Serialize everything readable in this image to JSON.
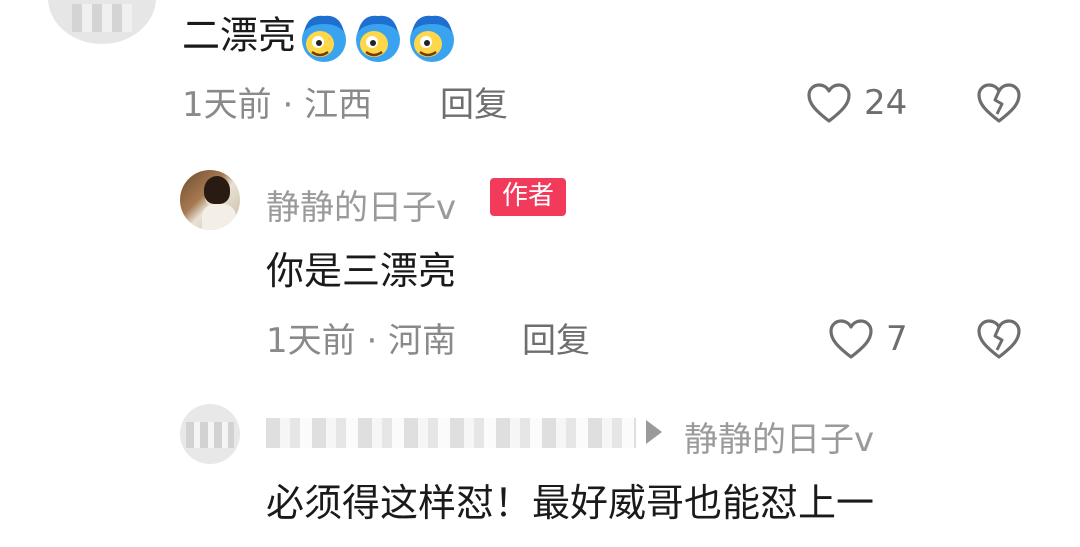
{
  "comments": [
    {
      "text": "二漂亮",
      "emoji": "laughing-face-emoji",
      "time": "1天前",
      "separator": "·",
      "location": "江西",
      "reply_label": "回复",
      "likes": "24"
    },
    {
      "username": "静静的日子v",
      "badge": "作者",
      "text": "你是三漂亮",
      "time": "1天前",
      "separator": "·",
      "location": "河南",
      "reply_label": "回复",
      "likes": "7"
    },
    {
      "reply_to": "静静的日子v",
      "text": "必须得这样怼！最好威哥也能怼上一"
    }
  ],
  "colors": {
    "badge": "#f23b5a",
    "meta": "#8a8a8a",
    "text": "#1a1a1a"
  }
}
